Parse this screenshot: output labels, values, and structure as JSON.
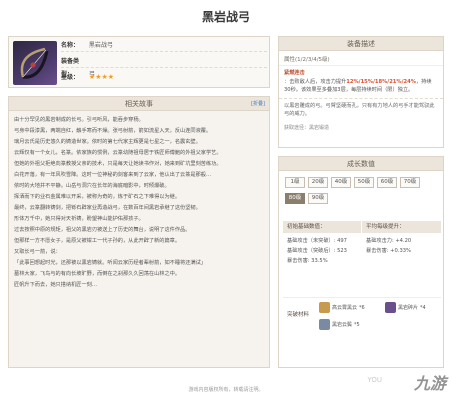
{
  "page": {
    "title": "黑岩战弓"
  },
  "info": {
    "name_key": "名称：",
    "name_val": "黑岩战弓",
    "type_key": "装备类型：",
    "type_val": "弓",
    "rank_key": "星级：",
    "stars": "★★★★"
  },
  "story": {
    "header": "相关故事",
    "toggle": "[折叠]",
    "paragraphs": [
      "由十分罕见的黑岩制成的长弓。引弓听风，能吞步穿杨。",
      "弓身中段漆黑，两端自红，触手寒而不燥。张弓射箭，箭如流星入天，反山连同液覆。",
      "璃月云氏是历史悠久的铸造世家。依时的第七代家主辉更是七星之一，名震玄壁。",
      "云辉仅有一个女儿，名篆。依家族的惯例，云篆幼随祖母居于铁匠师傅鲍的外祖父家学艺。",
      "但她的外祖父拒绝向篆教授父亲的技术，只是每天让她读书作对，她来到矿坑里刻苦练功。",
      "白花开落，有一年风吹雪降。这时一位神秘的剑客来到了云家，他认出了云篆是那般…",
      "依时的大地并不平静。山岳与洞穴在长年的海底暗影中，时倾爆破。",
      "挥洒而下的业石金属难以开采，被称为奇的，炼于矿石之下难得以为继。",
      "最终，云篆翻转铸剑，把铄石辟家业再造战弓，在数百年间黑岩承继了这份坚韧。",
      "形体万千中，她只得对天祈祷，盼望神山能护佑那孩子。",
      "过去按照中原的规矩，祖父的黑岩刃被送上了历史的舞台，说明了这件作品。",
      "但那样一方不愿女子，是原父被钳工一代子孙的，从此开辟了新的篇章。",
      "又取长弓一箭，说：",
      "「此事回想起时光，还那被以黑岩铸就。听闻云家历经者辈射箭，如不睡将还满试」",
      "墓林大家，飞鸟与的有向长坡旷野，而倒在之刹那久久回荡在山林之中。",
      "匠帆升下而去，她只搭纳机匠一刻…"
    ]
  },
  "skill": {
    "header": "装备描述",
    "subtitle": "属性(1/2/3/4/5级)",
    "name": "紧燃连击",
    "line1": "：击败敌人后，攻击力提升",
    "values": "12%/15%/18%/21%/24%",
    "line2": "，持续30秒。该效果至多叠加3层，每层持续时间（限）独立。",
    "flavor": "以黑岩雕成的弓。弓臂坚硬而孔，只有有力地人的弓手才能驾驭此弓的威力。",
    "source": "获取途径：黑岩锻造"
  },
  "growth": {
    "header": "成长数值",
    "levels_row1": [
      "1级",
      "20级",
      "40级",
      "50级",
      "60级",
      "70级"
    ],
    "levels_row2": [
      "80级",
      "90级"
    ],
    "active_level": "80级",
    "col1_head": "初始基础数值：",
    "col2_head": "平均每级提升：",
    "stats_left": [
      "基础攻击（未突破）: 497",
      "基础攻击（突破后）: 523",
      "暴击伤害: 33.5%"
    ],
    "stats_right": [
      "基础攻击力: +4.20",
      "暴击伤害: +0.33%"
    ],
    "mat_label": "突破材料",
    "materials": [
      {
        "name": "高云霄黑云",
        "count": "*6"
      },
      {
        "name": "黑岩碎片",
        "count": "*4"
      },
      {
        "name": "黑岩云鬓",
        "count": "*5"
      }
    ]
  },
  "footer": "游戏内容版权所有，转载请注明。",
  "watermark": "九游",
  "watermark_small": "YOU",
  "colors": {
    "accent": "#e05030",
    "panel_bg": "#f6f3ee",
    "header_bg": "#ebe5db",
    "active_level": "#8a7e6c",
    "star": "#f0a020"
  }
}
